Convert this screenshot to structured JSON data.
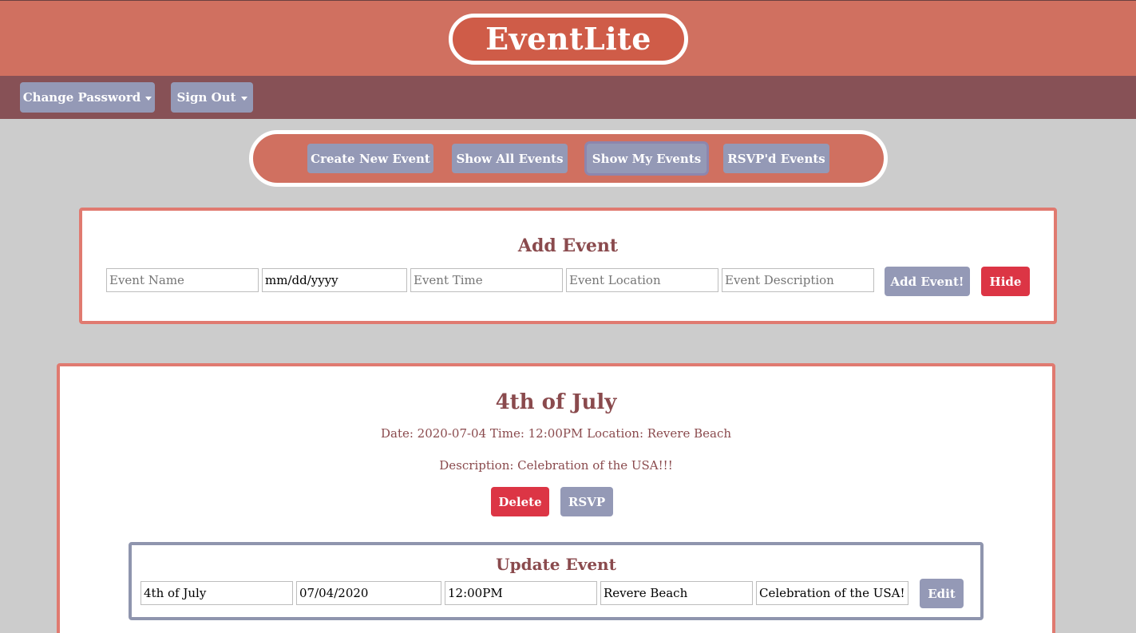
{
  "app": {
    "title": "EventLite"
  },
  "navbar": {
    "change_password": "Change Password",
    "sign_out": "Sign Out"
  },
  "menu": {
    "create": "Create New Event",
    "show_all": "Show All Events",
    "show_mine": "Show My Events",
    "rsvpd": "RSVP'd Events"
  },
  "add_event": {
    "title": "Add Event",
    "name_placeholder": "Event Name",
    "date_value": "mm/dd/yyyy",
    "time_placeholder": "Event Time",
    "location_placeholder": "Event Location",
    "description_placeholder": "Event Description",
    "submit": "Add Event!",
    "hide": "Hide"
  },
  "event": {
    "title": "4th of July",
    "details": "Date: 2020-07-04 Time: 12:00PM Location: Revere Beach",
    "description": "Description: Celebration of the USA!!!",
    "delete": "Delete",
    "rsvp": "RSVP"
  },
  "update_event": {
    "title": "Update Event",
    "name": "4th of July",
    "date": "07/04/2020",
    "time": "12:00PM",
    "location": "Revere Beach",
    "description": "Celebration of the USA!!!",
    "edit": "Edit"
  },
  "colors": {
    "header": "#d07060",
    "navbar": "#875156",
    "button": "#9499b6",
    "danger": "#dc3545",
    "card_border": "#e07a70",
    "title_text": "#8a4a4d"
  }
}
